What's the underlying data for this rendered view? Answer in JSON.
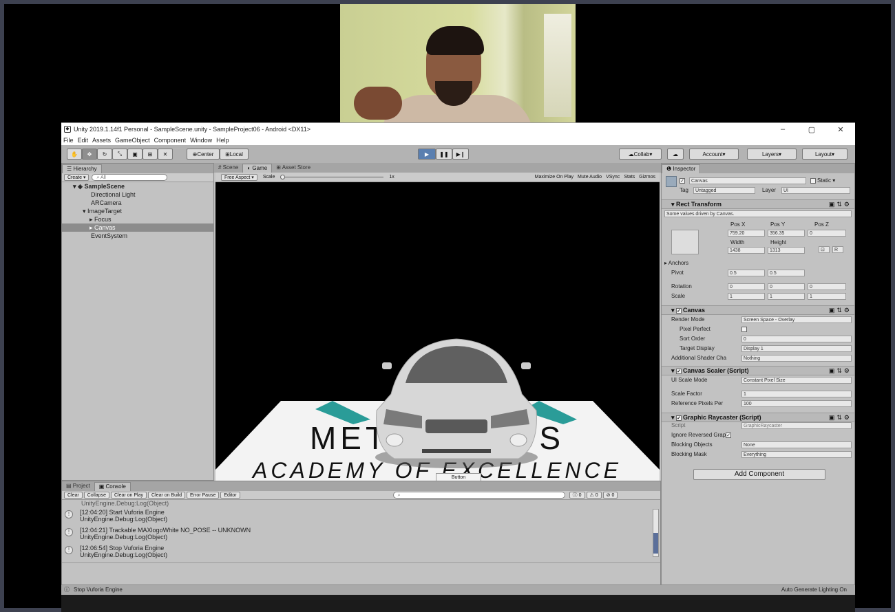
{
  "window": {
    "title": "Unity 2019.1.14f1 Personal - SampleScene.unity - SampleProject06 - Android <DX11>",
    "controls": [
      "–",
      "▢",
      "✕"
    ]
  },
  "menu": [
    "File",
    "Edit",
    "Assets",
    "GameObject",
    "Component",
    "Window",
    "Help"
  ],
  "toolbar": {
    "pivot": "Center",
    "space": "Local",
    "collab": "Collab",
    "account": "Account",
    "layers": "Layers",
    "layout": "Layout"
  },
  "hierarchy": {
    "tab": "Hierarchy",
    "create": "Create",
    "search_placeholder": "All",
    "scene": "SampleScene",
    "items": [
      "Directional Light",
      "ARCamera",
      "ImageTarget",
      "Focus",
      "Canvas",
      "EventSystem"
    ],
    "selected_index": 4
  },
  "center_tabs": [
    "Scene",
    "Game",
    "Asset Store"
  ],
  "game_bar": {
    "aspect": "Free Aspect",
    "scale_label": "Scale",
    "scale_value": "1x",
    "options": [
      "Maximize On Play",
      "Mute Audio",
      "VSync",
      "Stats",
      "Gizmos"
    ]
  },
  "game_view": {
    "marker_line1": "METAVERSUS",
    "marker_line2": "ACADEMY OF EXCELLENCE",
    "button_label": "Button"
  },
  "inspector": {
    "tab": "Inspector",
    "object_name": "Canvas",
    "static_label": "Static",
    "tag_label": "Tag",
    "tag_value": "Untagged",
    "layer_label": "Layer",
    "layer_value": "UI",
    "rect_transform": {
      "title": "Rect Transform",
      "note": "Some values driven by Canvas.",
      "pos_x_label": "Pos X",
      "pos_y_label": "Pos Y",
      "pos_z_label": "Pos Z",
      "pos_x": "759.20",
      "pos_y": "356.35",
      "pos_z": "0",
      "width_label": "Width",
      "height_label": "Height",
      "width": "1438",
      "height": "1313",
      "anchors": "Anchors",
      "pivot_label": "Pivot",
      "pivot_x": "0.5",
      "pivot_y": "0.5",
      "rotation_label": "Rotation",
      "rot_x": "0",
      "rot_y": "0",
      "rot_z": "0",
      "scale_label": "Scale",
      "scale_x": "1",
      "scale_y": "1",
      "scale_z": "1"
    },
    "canvas": {
      "title": "Canvas",
      "render_mode_label": "Render Mode",
      "render_mode": "Screen Space - Overlay",
      "pixel_perfect_label": "Pixel Perfect",
      "sort_order_label": "Sort Order",
      "sort_order": "0",
      "target_display_label": "Target Display",
      "target_display": "Display 1",
      "shader_label": "Additional Shader Cha",
      "shader_value": "Nothing"
    },
    "scaler": {
      "title": "Canvas Scaler (Script)",
      "ui_scale_label": "UI Scale Mode",
      "ui_scale": "Constant Pixel Size",
      "scale_factor_label": "Scale Factor",
      "scale_factor": "1",
      "ref_pixels_label": "Reference Pixels Per",
      "ref_pixels": "100"
    },
    "raycaster": {
      "title": "Graphic Raycaster (Script)",
      "script_label": "Script",
      "script_value": "GraphicRaycaster",
      "ignore_label": "Ignore Reversed Grap",
      "blocking_objects_label": "Blocking Objects",
      "blocking_objects": "None",
      "blocking_mask_label": "Blocking Mask",
      "blocking_mask": "Everything"
    },
    "add_component": "Add Component"
  },
  "console": {
    "tabs": [
      "Project",
      "Console"
    ],
    "buttons": [
      "Clear",
      "Collapse",
      "Clear on Play",
      "Clear on Build",
      "Error Pause",
      "Editor"
    ],
    "counts": [
      "0",
      "0",
      "0"
    ],
    "partial_line": "UnityEngine.Debug:Log(Object)",
    "entries": [
      {
        "line1": "[12:04:20] Start Vuforia Engine",
        "line2": "UnityEngine.Debug:Log(Object)"
      },
      {
        "line1": "[12:04:21] Trackable MAXlogoWhite NO_POSE -- UNKNOWN",
        "line2": "UnityEngine.Debug:Log(Object)"
      },
      {
        "line1": "[12:06:54] Stop Vuforia Engine",
        "line2": "UnityEngine.Debug:Log(Object)"
      }
    ]
  },
  "status": {
    "message": "Stop Vuforia Engine",
    "right": "Auto Generate Lighting On"
  }
}
